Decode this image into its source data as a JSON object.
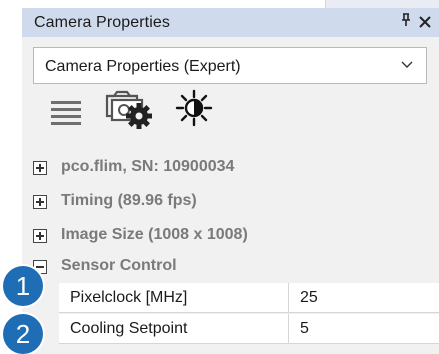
{
  "window": {
    "title": "Camera Properties",
    "pin_glyph": "↧",
    "close_glyph": "✕"
  },
  "mode_select": {
    "value": "Camera Properties (Expert)",
    "icon": "chevron-down-icon"
  },
  "toolbar": {
    "icons": [
      "menu-icon",
      "camera-settings-icon",
      "brightness-contrast-icon"
    ]
  },
  "tree": {
    "groups": [
      {
        "label": "pco.flim, SN: 10900034",
        "expanded": false
      },
      {
        "label": "Timing (89.96 fps)",
        "expanded": false
      },
      {
        "label": "Image Size (1008 x 1008)",
        "expanded": false
      },
      {
        "label": "Sensor Control",
        "expanded": true
      }
    ],
    "properties": [
      {
        "name": "Pixelclock [MHz]",
        "value": "25"
      },
      {
        "name": "Cooling Setpoint",
        "value": "5"
      }
    ]
  },
  "callouts": [
    "1",
    "2"
  ],
  "colors": {
    "title_bar": "#cfdbed",
    "callout": "#1f6eb5",
    "group_text": "#7a7a7a"
  }
}
